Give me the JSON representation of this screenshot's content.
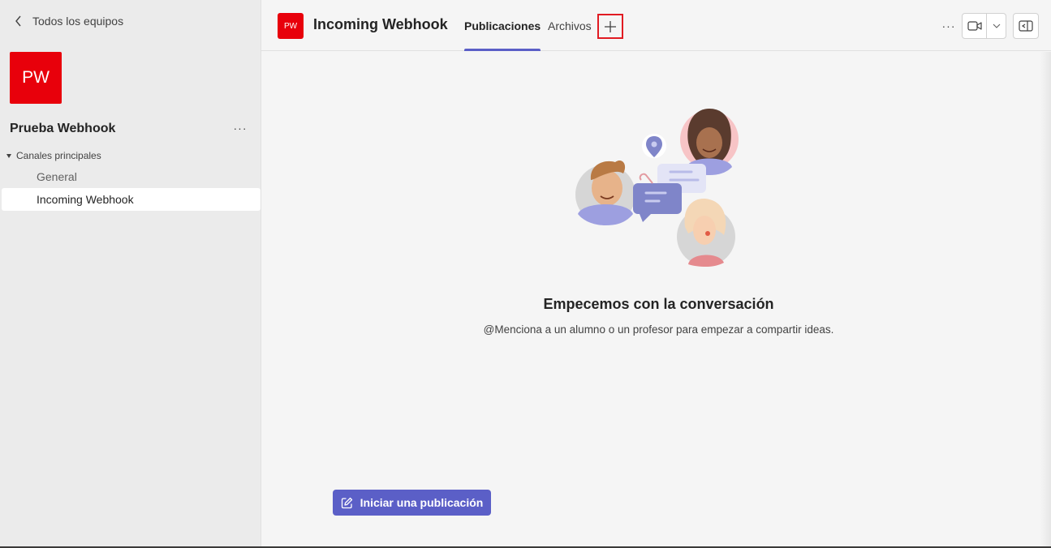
{
  "sidebar": {
    "back_label": "Todos los equipos",
    "team_initials": "PW",
    "team_name": "Prueba Webhook",
    "more_label": "···",
    "section_label": "Canales principales",
    "channels": [
      {
        "label": "General"
      },
      {
        "label": "Incoming Webhook"
      }
    ]
  },
  "header": {
    "team_initials": "PW",
    "channel_title": "Incoming Webhook",
    "tabs": [
      {
        "label": "Publicaciones"
      },
      {
        "label": "Archivos"
      }
    ],
    "more_label": "···"
  },
  "main": {
    "empty_title": "Empecemos con la conversación",
    "empty_subtitle": "@Menciona a un alumno o un profesor para empezar a compartir ideas.",
    "start_post_label": "Iniciar una publicación"
  },
  "colors": {
    "team_red": "#e8000b",
    "accent": "#5b5fc7",
    "highlight_box": "#e11b22"
  },
  "icons": [
    "chevron-left-icon",
    "ellipsis-icon",
    "caret-down-icon",
    "add-icon",
    "video-camera-icon",
    "chevron-down-icon",
    "open-panel-icon",
    "compose-icon"
  ]
}
